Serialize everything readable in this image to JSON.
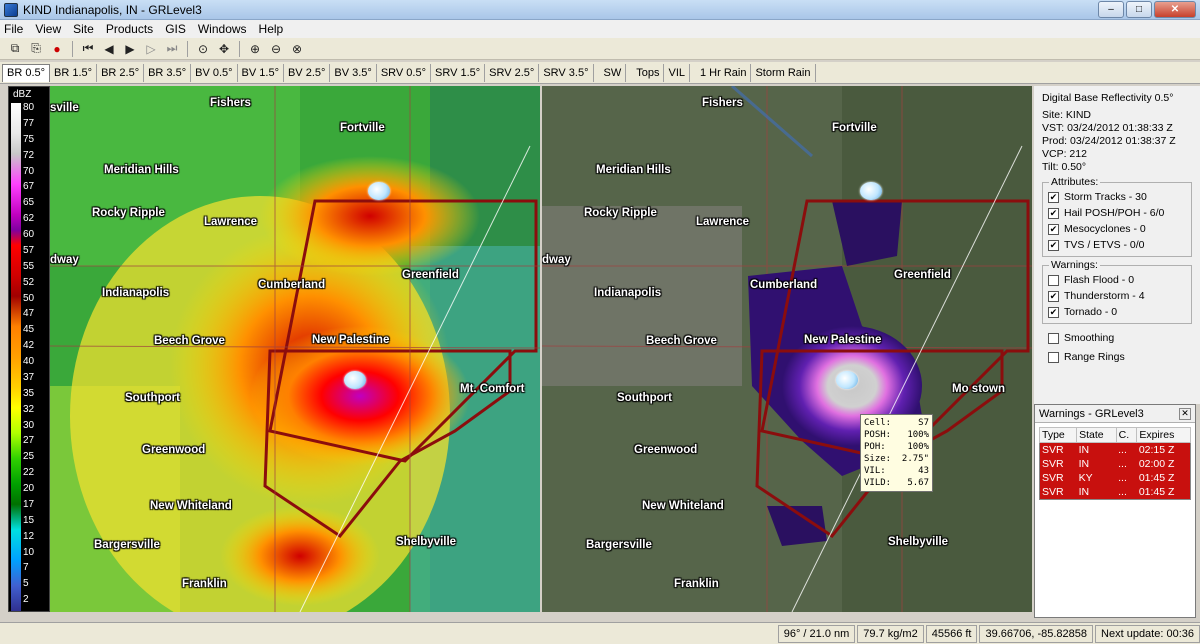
{
  "window": {
    "title": "KIND Indianapolis, IN - GRLevel3",
    "minimize": "–",
    "maximize": "□",
    "close": "✕"
  },
  "menu": [
    "File",
    "View",
    "Site",
    "Products",
    "GIS",
    "Windows",
    "Help"
  ],
  "toolbar_icons": [
    "copy-icon",
    "paste-icon",
    "record-icon",
    "first-frame-icon",
    "prev-frame-icon",
    "play-icon",
    "next-frame-icon",
    "last-frame-icon",
    "zoom-icon",
    "pan-icon",
    "zoom-in-icon",
    "zoom-out-icon",
    "zoom-reset-icon"
  ],
  "toolbar_glyphs": [
    "⧉",
    "⎘",
    "●",
    "⏮",
    "◀",
    "▶",
    "▷",
    "⏭",
    "⊙",
    "✥",
    "⊕",
    "⊖",
    "⊗"
  ],
  "tabs": [
    "BR 0.5°",
    "BR 1.5°",
    "BR 2.5°",
    "BR 3.5°",
    "BV 0.5°",
    "BV 1.5°",
    "BV 2.5°",
    "BV 3.5°",
    "SRV 0.5°",
    "SRV 1.5°",
    "SRV 2.5°",
    "SRV 3.5°",
    "SW",
    "Tops",
    "VIL",
    "1 Hr Rain",
    "Storm Rain"
  ],
  "active_tab": 0,
  "legend": {
    "unit": "dBZ",
    "labels": [
      "80",
      "77",
      "75",
      "72",
      "70",
      "67",
      "65",
      "62",
      "60",
      "57",
      "55",
      "52",
      "50",
      "47",
      "45",
      "42",
      "40",
      "37",
      "35",
      "32",
      "30",
      "27",
      "25",
      "22",
      "20",
      "17",
      "15",
      "12",
      "10",
      "7",
      "5",
      "2"
    ]
  },
  "cities_left": [
    "Fishers",
    "Fortville",
    "Meridian Hills",
    "Rocky Ripple",
    "Lawrence",
    "Cumberland",
    "Greenfield",
    "Indianapolis",
    "Beech Grove",
    "New Palestine",
    "Southport",
    "Mt. Comfort",
    "Greenwood",
    "New Whiteland",
    "Bargersville",
    "Franklin",
    "Shelbyville",
    "dway",
    "sville",
    "M"
  ],
  "cities_right": [
    "Fishers",
    "Fortville",
    "Meridian Hills",
    "Rocky Ripple",
    "Lawrence",
    "Cumberland",
    "Greenfield",
    "Indianapolis",
    "Beech Grove",
    "New Palestine",
    "Southport",
    "Mo   stown",
    "Greenwood",
    "New Whiteland",
    "Bargersville",
    "Franklin",
    "Shelbyville",
    "dway"
  ],
  "tooltip": {
    "rows": [
      {
        "k": "Cell:",
        "v": "S7"
      },
      {
        "k": "POSH:",
        "v": "100%"
      },
      {
        "k": "POH:",
        "v": "100%"
      },
      {
        "k": "Size:",
        "v": "2.75\""
      },
      {
        "k": "VIL:",
        "v": "43"
      },
      {
        "k": "VILD:",
        "v": "5.67"
      }
    ]
  },
  "info": {
    "product": "Digital Base Reflectivity 0.5°",
    "site": "Site:  KIND",
    "vst": "VST:  03/24/2012  01:38:33 Z",
    "prod": "Prod: 03/24/2012  01:38:37 Z",
    "vcp": "VCP:  212",
    "tilt": "Tilt:   0.50°",
    "attributes_label": "Attributes:",
    "attributes": [
      {
        "label": "Storm Tracks - 30",
        "checked": true
      },
      {
        "label": "Hail POSH/POH - 6/0",
        "checked": true
      },
      {
        "label": "Mesocyclones - 0",
        "checked": true
      },
      {
        "label": "TVS / ETVS - 0/0",
        "checked": true
      }
    ],
    "warnings_label": "Warnings:",
    "warning_filters": [
      {
        "label": "Flash Flood - 0",
        "checked": false
      },
      {
        "label": "Thunderstorm - 4",
        "checked": true
      },
      {
        "label": "Tornado - 0",
        "checked": true
      }
    ],
    "smoothing": "Smoothing",
    "range_rings": "Range Rings"
  },
  "warnings_window": {
    "title": "Warnings - GRLevel3",
    "columns": [
      "Type",
      "State",
      "C.",
      "Expires"
    ],
    "rows": [
      [
        "SVR",
        "IN",
        "...",
        "02:15 Z"
      ],
      [
        "SVR",
        "IN",
        "...",
        "02:00 Z"
      ],
      [
        "SVR",
        "KY",
        "...",
        "01:45 Z"
      ],
      [
        "SVR",
        "IN",
        "...",
        "01:45 Z"
      ]
    ]
  },
  "status": {
    "azimuth": "96° / 21.0 nm",
    "vil": "79.7 kg/m2",
    "height": "45566 ft",
    "coords": "39.66706, -85.82858",
    "next_update": "Next update: 00:36"
  },
  "colors": {
    "warning_polygon": "#8b0d0d",
    "warning_row": "#c8100e",
    "map_bg_left": "#2e9e3a",
    "map_bg_right": "#4a5a3a"
  }
}
